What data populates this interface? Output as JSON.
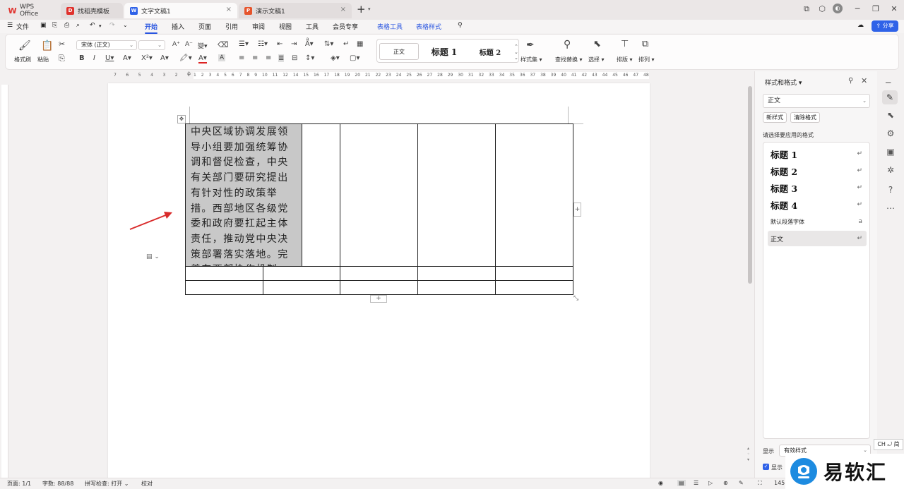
{
  "tabs": [
    {
      "label": "WPS Office",
      "icon": "wps-logo-icon"
    },
    {
      "label": "找稻壳模板",
      "icon": "docer-icon"
    },
    {
      "label": "文字文稿1",
      "icon": "writer-icon",
      "active": true
    },
    {
      "label": "演示文稿1",
      "icon": "presentation-icon"
    }
  ],
  "menu": {
    "file": "文件",
    "items": [
      "开始",
      "插入",
      "页面",
      "引用",
      "审阅",
      "视图",
      "工具",
      "会员专享"
    ],
    "context": [
      "表格工具",
      "表格样式"
    ],
    "share": "分享"
  },
  "ribbon": {
    "format_painter": "格式刷",
    "paste": "粘贴",
    "font_name": "宋体 (正文)",
    "font_size": "",
    "styles_label": "样式集",
    "find_replace": "查找替换",
    "select": "选择",
    "layout": "排版",
    "arrange": "排列",
    "gallery": [
      "正文",
      "标题 1",
      "标题 2"
    ]
  },
  "ruler": {
    "left_numbers": [
      "7",
      "6",
      "5",
      "4",
      "3",
      "2",
      "1"
    ],
    "right_numbers": [
      "1",
      "2",
      "3",
      "4",
      "5",
      "6",
      "7",
      "8",
      "9",
      "10",
      "11",
      "12",
      "14",
      "15",
      "16",
      "17",
      "18",
      "19",
      "20",
      "21",
      "22",
      "23",
      "24",
      "25",
      "26",
      "27",
      "28",
      "29",
      "30",
      "31",
      "32",
      "33",
      "34",
      "35",
      "36",
      "37",
      "38",
      "39",
      "40",
      "41",
      "42",
      "43",
      "44",
      "45",
      "46",
      "47",
      "48"
    ]
  },
  "document": {
    "cell_text": "中央区域协调发展领导小组要加强统筹协调和督促检查，中央有关部门要研究提出有针对性的政策举措。西部地区各级党委和政府要扛起主体责任，推动党中央决策部署落实落地。完善东西部协作机制"
  },
  "panel": {
    "title": "样式和格式",
    "current_style": "正文",
    "new_style": "新样式",
    "clear_format": "清除格式",
    "instruction": "请选择要应用的格式",
    "styles": [
      {
        "label": "标题 1",
        "kind": "heading"
      },
      {
        "label": "标题 2",
        "kind": "heading"
      },
      {
        "label": "标题 3",
        "kind": "heading"
      },
      {
        "label": "标题 4",
        "kind": "heading"
      },
      {
        "label": "默认段落字体",
        "kind": "plain"
      },
      {
        "label": "正文",
        "kind": "plain",
        "selected": true
      }
    ],
    "show_label": "显示",
    "show_value": "有效样式",
    "show_preview": "显示"
  },
  "ime": "CH ⤾ 简",
  "status": {
    "page": "页面: 1/1",
    "words": "字数: 88/88",
    "spell": "拼写检查: 打开",
    "proof": "校对",
    "zoom": "145"
  },
  "watermark": "易软汇",
  "colors": {
    "accent": "#2955e0",
    "shaded_cell": "#c8c8c8",
    "arrow": "#d92b2b"
  }
}
